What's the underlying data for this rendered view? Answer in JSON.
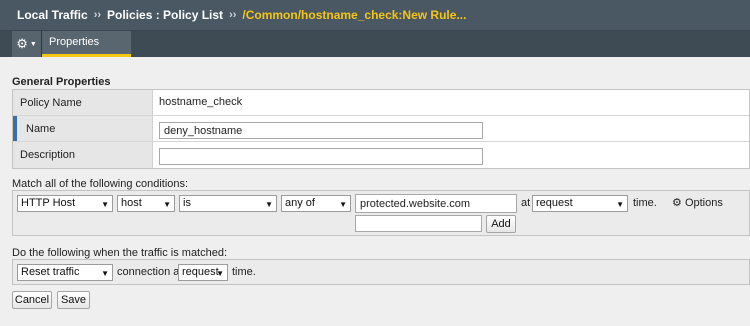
{
  "breadcrumb": {
    "root": "Local Traffic",
    "separator": "››",
    "section": "Policies : Policy List",
    "current": "/Common/hostname_check:New Rule..."
  },
  "tabs": {
    "gear_icon": "gear-icon",
    "properties": "Properties"
  },
  "general_properties": {
    "title": "General Properties",
    "policy_name_label": "Policy Name",
    "policy_name_value": "hostname_check",
    "name_label": "Name",
    "name_value": "deny_hostname",
    "description_label": "Description",
    "description_value": ""
  },
  "conditions": {
    "title": "Match all of the following conditions:",
    "operand": "HTTP Host",
    "selector": "host",
    "condition": "is",
    "match_type": "any of",
    "value": "protected.website.com",
    "at_text": "at",
    "event": "request",
    "time_text": "time.",
    "options_label": "Options",
    "new_value": "",
    "add_label": "Add"
  },
  "actions": {
    "title": "Do the following when the traffic is matched:",
    "action": "Reset traffic",
    "connection_at_text": "connection at",
    "event": "request",
    "time_text": "time."
  },
  "buttons": {
    "cancel": "Cancel",
    "save": "Save"
  },
  "colors": {
    "titlebar_bg": "#4a5864",
    "accent_yellow": "#f5c518",
    "active_marker": "#3a6ea5"
  }
}
